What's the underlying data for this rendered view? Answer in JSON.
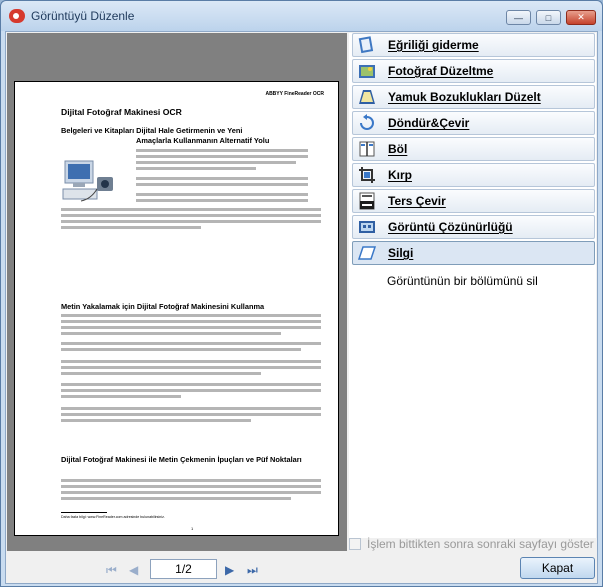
{
  "window": {
    "title": "Görüntüyü Düzenle"
  },
  "preview": {
    "doc_header": "ABBYY FineReader OCR",
    "doc_title": "Dijital Fotoğraf Makinesi OCR",
    "heading1_line1": "Belgeleri ve Kitapları Dijital Hale Getirmenin ve Yeni",
    "heading1_line2": "Amaçlarla Kullanmanın Alternatif Yolu",
    "heading2": "Metin Yakalamak için Dijital Fotoğraf Makinesini Kullanma",
    "heading3": "Dijital Fotoğraf Makinesi ile Metin Çekmenin İpuçları ve Püf Noktaları",
    "footnote": "Daha fazla bilgi: www.FineReader.com adresinde bulunabilirsiniz.",
    "page_number": "1"
  },
  "nav": {
    "page_indicator": "1/2"
  },
  "tools": [
    {
      "label": "Eğriliği giderme",
      "icon": "deskew-icon"
    },
    {
      "label": "Fotoğraf Düzeltme",
      "icon": "photo-correction-icon"
    },
    {
      "label": "Yamuk Bozuklukları Düzelt",
      "icon": "trapezoid-icon"
    },
    {
      "label": "Döndür&Çevir",
      "icon": "rotate-icon"
    },
    {
      "label": "Böl",
      "icon": "split-icon"
    },
    {
      "label": "Kırp",
      "icon": "crop-icon"
    },
    {
      "label": "Ters Çevir",
      "icon": "invert-icon"
    },
    {
      "label": "Görüntü Çözünürlüğü",
      "icon": "resolution-icon"
    },
    {
      "label": "Silgi",
      "icon": "eraser-icon"
    }
  ],
  "description": "Görüntünün bir bölümünü sil",
  "footer": {
    "checkbox_label": "İşlem bittikten sonra sonraki sayfayı göster",
    "close_button": "Kapat"
  }
}
